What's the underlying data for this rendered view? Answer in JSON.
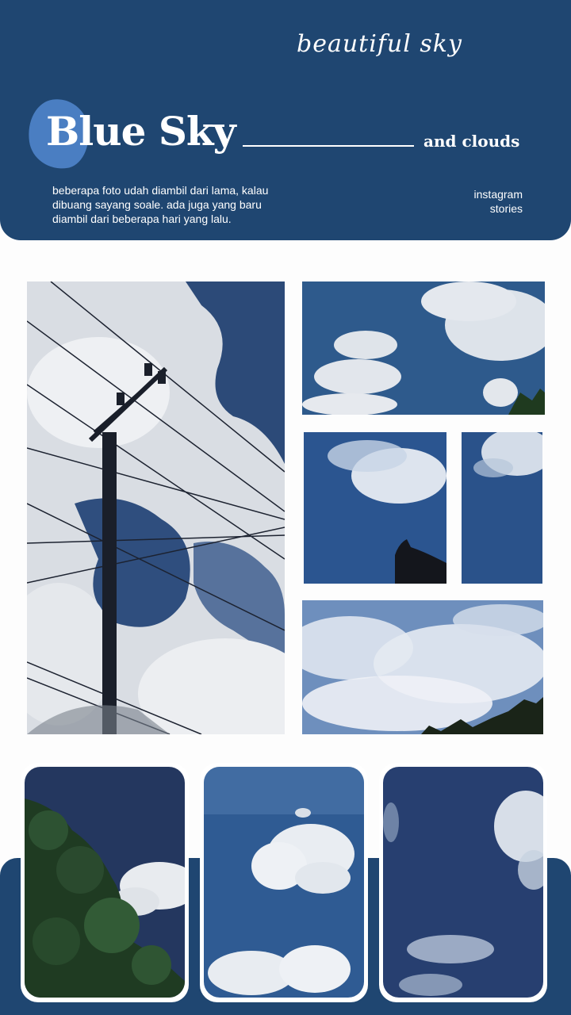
{
  "header": {
    "script_title": "beautiful sky",
    "title": "Blue Sky",
    "subtitle": "and clouds",
    "description_lines": [
      "beberapa foto udah diambil dari lama, kalau",
      "dibuang sayang soale. ada juga yang baru",
      "diambil dari beberapa hari yang lalu."
    ],
    "tag_lines": [
      "instagram",
      "stories"
    ]
  },
  "colors": {
    "navy": "#1f4671",
    "accent_blob": "#4a7ec2",
    "background": "#fdfdfd"
  },
  "photos": [
    {
      "subject": "power-pole-clouds"
    },
    {
      "subject": "cumulus-clouds"
    },
    {
      "subject": "cloud-with-cat-silhouette"
    },
    {
      "subject": "blue-sky-wisp"
    },
    {
      "subject": "altocumulus-sky"
    }
  ],
  "cards": [
    {
      "subject": "tree-and-sky"
    },
    {
      "subject": "fluffy-cloud"
    },
    {
      "subject": "wispy-clouds"
    }
  ]
}
